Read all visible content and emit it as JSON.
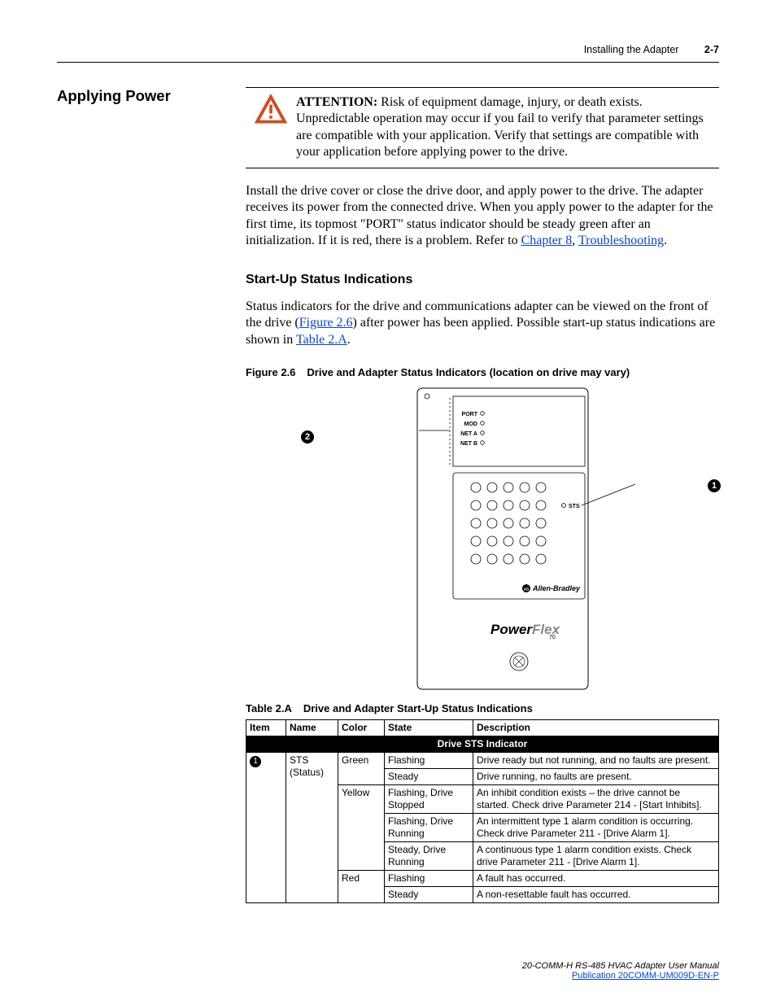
{
  "header": {
    "chapter": "Installing the Adapter",
    "page": "2-7"
  },
  "section_heading": "Applying Power",
  "attention": {
    "label": "ATTENTION:",
    "text": "Risk of equipment damage, injury, or death exists. Unpredictable operation may occur if you fail to verify that parameter settings are compatible with your application. Verify that settings are compatible with your application before applying power to the drive."
  },
  "para1_a": "Install the drive cover or close the drive door, and apply power to the drive. The adapter receives its power from the connected drive. When you apply power to the adapter for the first time, its topmost \"PORT\" status indicator should be steady green after an initialization. If it is red, there is a problem. Refer to ",
  "para1_link1": "Chapter 8",
  "para1_sep": ", ",
  "para1_link2": "Troubleshooting",
  "para1_end": ".",
  "sub_heading": "Start-Up Status Indications",
  "para2_a": "Status indicators for the drive and communications adapter can be viewed on the front of the drive (",
  "para2_link1": "Figure 2.6",
  "para2_b": ") after power has been applied. Possible start-up status indications are shown in ",
  "para2_link2": "Table 2.A",
  "para2_end": ".",
  "figure": {
    "num": "Figure 2.6",
    "title": "Drive and Adapter Status Indicators (location on drive may vary)",
    "leds": [
      "PORT",
      "MOD",
      "NET A",
      "NET B"
    ],
    "sts_label": "STS",
    "brand": "Allen-Bradley",
    "product_a": "Power",
    "product_b": "Flex",
    "product_sub": "70",
    "callout1": "➊",
    "callout2": "➋"
  },
  "table": {
    "num": "Table 2.A",
    "title": "Drive and Adapter Start-Up Status Indications",
    "headers": [
      "Item",
      "Name",
      "Color",
      "State",
      "Description"
    ],
    "section_header": "Drive STS Indicator",
    "item1": "➊",
    "name1a": "STS",
    "name1b": "(Status)",
    "rows": [
      {
        "color": "Green",
        "state": "Flashing",
        "desc": "Drive ready but not running, and no faults are present."
      },
      {
        "color": "",
        "state": "Steady",
        "desc": "Drive running, no faults are present."
      },
      {
        "color": "Yellow",
        "state": "Flashing, Drive Stopped",
        "desc": "An inhibit condition exists – the drive cannot be started. Check drive Parameter 214 - [Start Inhibits]."
      },
      {
        "color": "",
        "state": "Flashing, Drive Running",
        "desc": "An intermittent type 1 alarm condition is occurring. Check drive Parameter 211 - [Drive Alarm 1]."
      },
      {
        "color": "",
        "state": "Steady, Drive Running",
        "desc": "A continuous type 1 alarm condition exists. Check drive Parameter 211 - [Drive Alarm 1]."
      },
      {
        "color": "Red",
        "state": "Flashing",
        "desc": "A fault has occurred."
      },
      {
        "color": "",
        "state": "Steady",
        "desc": "A non-resettable fault has occurred."
      }
    ]
  },
  "footer": {
    "manual": "20-COMM-H RS-485 HVAC Adapter User Manual",
    "pub": "Publication 20COMM-UM009D-EN-P"
  },
  "chart_data": {
    "type": "table",
    "title": "Drive and Adapter Start-Up Status Indications",
    "columns": [
      "Item",
      "Name",
      "Color",
      "State",
      "Description"
    ],
    "section": "Drive STS Indicator",
    "rows": [
      [
        "1",
        "STS (Status)",
        "Green",
        "Flashing",
        "Drive ready but not running, and no faults are present."
      ],
      [
        "1",
        "STS (Status)",
        "Green",
        "Steady",
        "Drive running, no faults are present."
      ],
      [
        "1",
        "STS (Status)",
        "Yellow",
        "Flashing, Drive Stopped",
        "An inhibit condition exists – the drive cannot be started. Check drive Parameter 214 - [Start Inhibits]."
      ],
      [
        "1",
        "STS (Status)",
        "Yellow",
        "Flashing, Drive Running",
        "An intermittent type 1 alarm condition is occurring. Check drive Parameter 211 - [Drive Alarm 1]."
      ],
      [
        "1",
        "STS (Status)",
        "Yellow",
        "Steady, Drive Running",
        "A continuous type 1 alarm condition exists. Check drive Parameter 211 - [Drive Alarm 1]."
      ],
      [
        "1",
        "STS (Status)",
        "Red",
        "Flashing",
        "A fault has occurred."
      ],
      [
        "1",
        "STS (Status)",
        "Red",
        "Steady",
        "A non-resettable fault has occurred."
      ]
    ]
  }
}
